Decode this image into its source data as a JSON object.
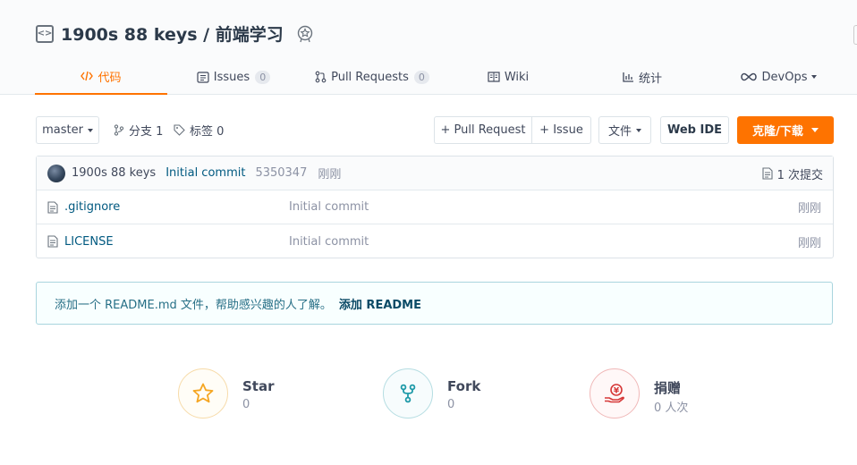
{
  "repo": {
    "title": "1900s 88 keys / 前端学习"
  },
  "tabs": [
    {
      "label": "代码",
      "icon": "code-icon",
      "active": true
    },
    {
      "label": "Issues",
      "count": "0",
      "icon": "issues-icon"
    },
    {
      "label": "Pull Requests",
      "count": "0",
      "icon": "pull-request-icon"
    },
    {
      "label": "Wiki",
      "icon": "wiki-icon"
    },
    {
      "label": "统计",
      "icon": "stats-icon"
    },
    {
      "label": "DevOps",
      "icon": "devops-icon"
    }
  ],
  "toolbar": {
    "branch": "master",
    "branches": "分支 1",
    "tags": "标签 0",
    "new_pr": "+ Pull Request",
    "new_issue": "+ Issue",
    "files": "文件",
    "web_ide": "Web IDE",
    "clone": "克隆/下载"
  },
  "commit": {
    "author": "1900s 88 keys",
    "message": "Initial commit",
    "sha": "5350347",
    "time": "刚刚",
    "count_label": "1 次提交"
  },
  "files": [
    {
      "name": ".gitignore",
      "message": "Initial commit",
      "time": "刚刚"
    },
    {
      "name": "LICENSE",
      "message": "Initial commit",
      "time": "刚刚"
    }
  ],
  "readme": {
    "text": "添加一个 README.md 文件，帮助感兴趣的人了解。",
    "link": "添加 README"
  },
  "stats": [
    {
      "label": "Star",
      "value": "0",
      "icon": "star-icon",
      "color": "#f5a623"
    },
    {
      "label": "Fork",
      "value": "0",
      "icon": "fork-icon",
      "color": "#1e9aa8"
    },
    {
      "label": "捐赠",
      "value": "0 人次",
      "icon": "donate-icon",
      "color": "#d63838"
    }
  ],
  "colors": {
    "accent": "#fe7300",
    "link": "#005980"
  }
}
